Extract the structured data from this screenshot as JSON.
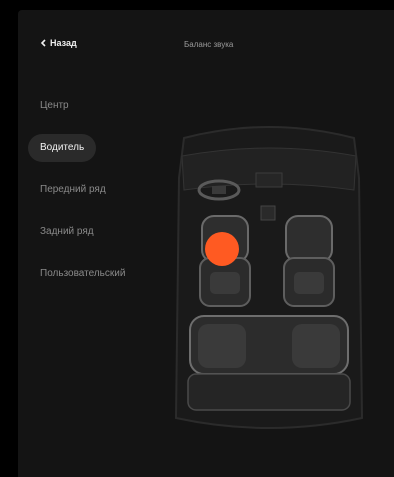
{
  "header": {
    "back_label": "Назад",
    "title": "Баланс звука"
  },
  "menu": {
    "items": [
      {
        "label": "Центр",
        "active": false
      },
      {
        "label": "Водитель",
        "active": true
      },
      {
        "label": "Передний ряд",
        "active": false
      },
      {
        "label": "Задний ряд",
        "active": false
      },
      {
        "label": "Пользовательский",
        "active": false
      }
    ]
  },
  "balance": {
    "selected_zone": "Водитель",
    "marker_color": "#ff5a22"
  }
}
